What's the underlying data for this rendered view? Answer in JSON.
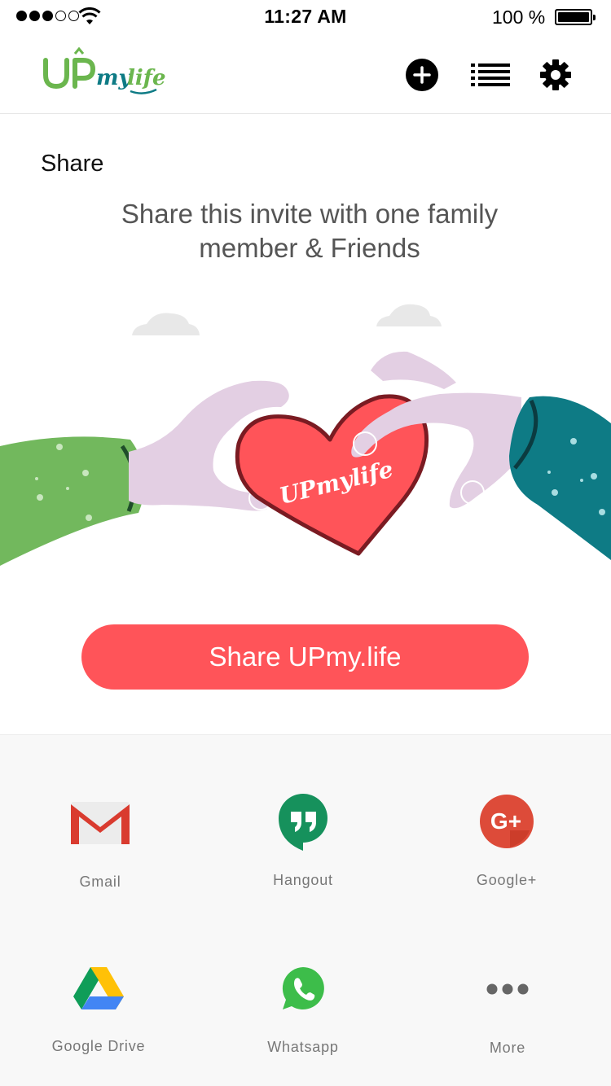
{
  "status_bar": {
    "time": "11:27 AM",
    "battery": "100 %",
    "signal_bars": 3,
    "signal_total": 5
  },
  "header": {
    "logo_text": "UPmylife",
    "icons": [
      "add-circle-icon",
      "list-icon",
      "gear-icon"
    ]
  },
  "page": {
    "title": "Share",
    "invite_text": "Share this invite with one family member & Friends",
    "illustration_logo": "UPmylife"
  },
  "share_button": {
    "label": "Share UPmy.life"
  },
  "share_options": [
    {
      "label": "Gmail",
      "icon": "gmail-icon"
    },
    {
      "label": "Hangout",
      "icon": "hangout-icon"
    },
    {
      "label": "Google+",
      "icon": "google-plus-icon"
    },
    {
      "label": "Google Drive",
      "icon": "google-drive-icon"
    },
    {
      "label": "Whatsapp",
      "icon": "whatsapp-icon"
    },
    {
      "label": "More",
      "icon": "more-icon"
    }
  ],
  "colors": {
    "accent": "#ff5459",
    "logo_green": "#6bb64e",
    "logo_teal": "#0e7b85",
    "label_gray": "#777777"
  }
}
